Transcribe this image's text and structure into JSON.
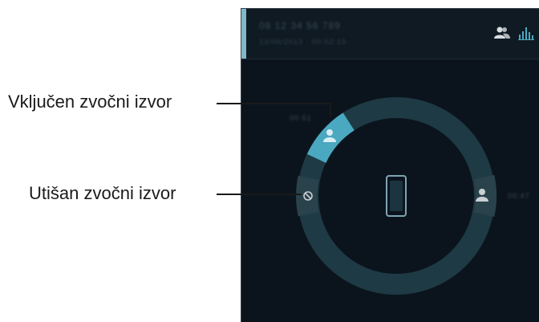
{
  "header": {
    "call_number": "08 12 34 56 789",
    "call_details": "13/06/2013 · 00:02:15",
    "icons": [
      "contacts-icon",
      "equalizer-icon"
    ]
  },
  "sources": {
    "active_label": "00:51",
    "silent_label": "",
    "right_label": "00:47"
  },
  "callouts": {
    "active": "Vključen zvočni izvor",
    "muted": "Utišan zvočni izvor"
  },
  "colors": {
    "background": "#0b141d",
    "ring": "#1e3a44",
    "active_segment": "#4aa8c0",
    "inactive_segment": "#2a424c",
    "accent": "#7fb8c8"
  }
}
